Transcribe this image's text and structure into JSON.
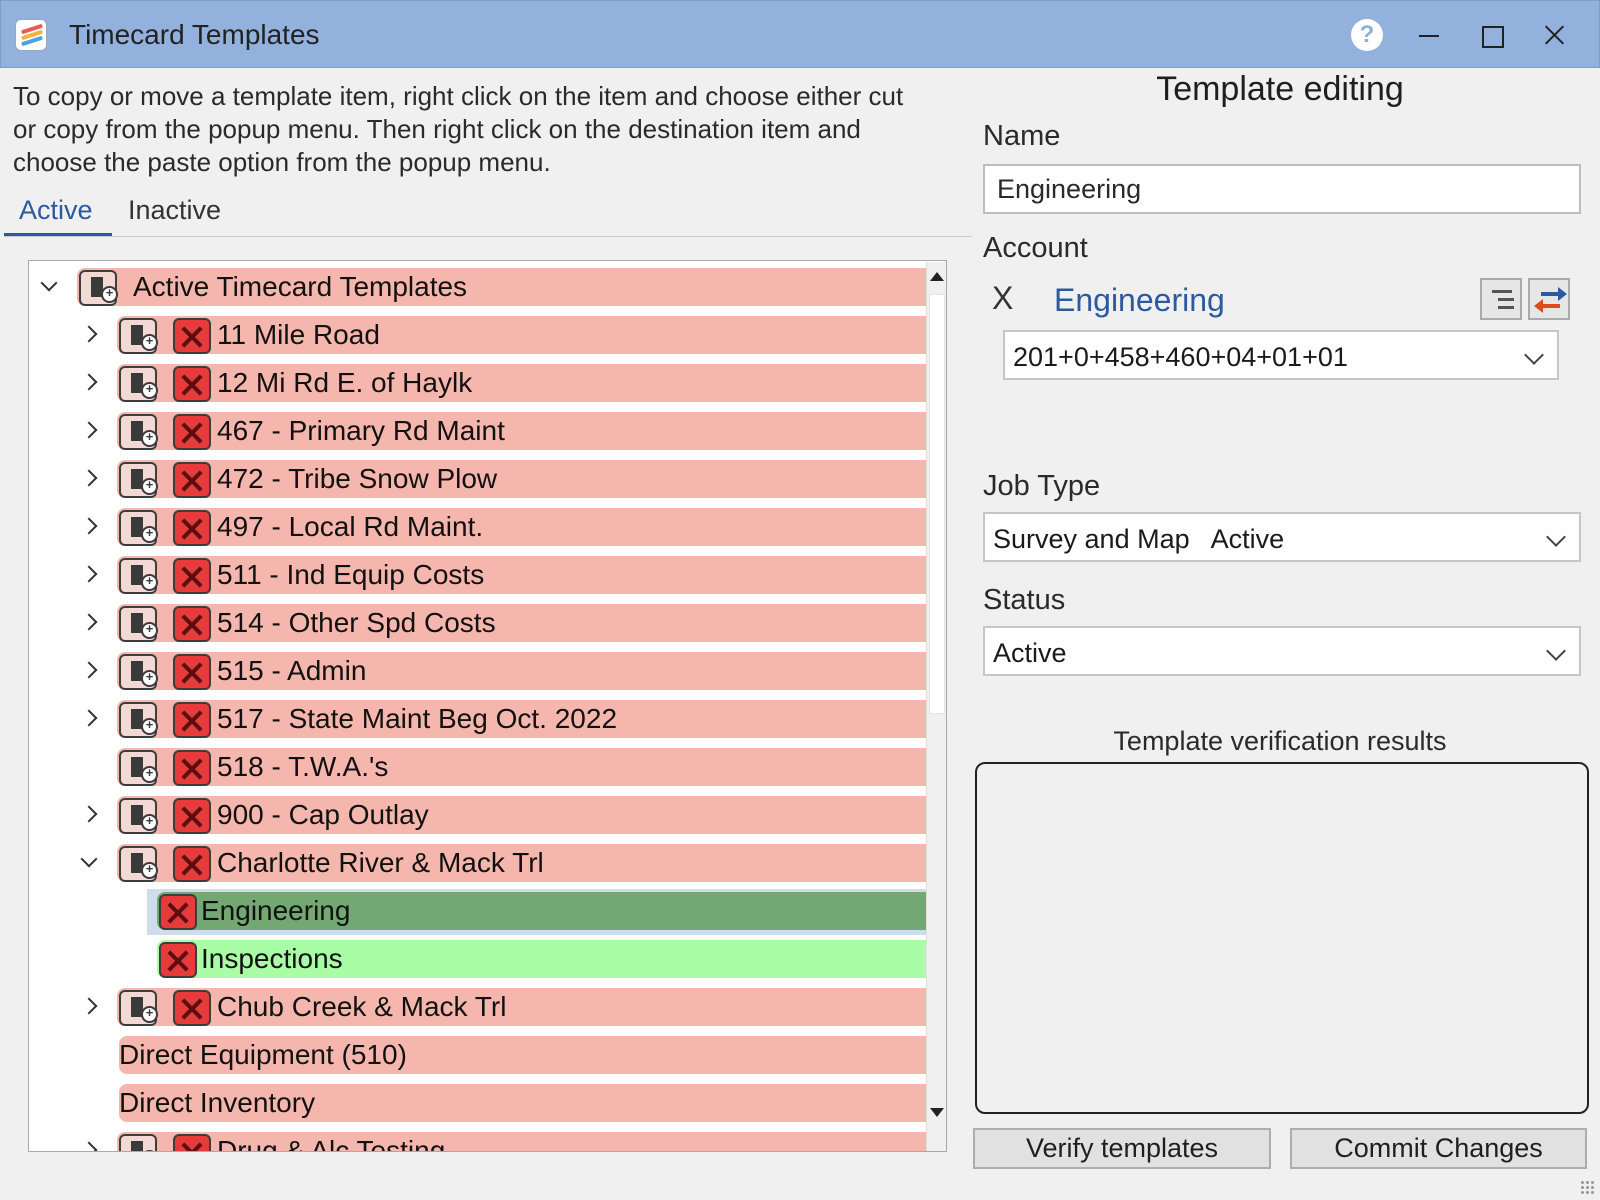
{
  "window": {
    "title": "Timecard Templates",
    "help_label": "?"
  },
  "instructions": "To copy or move a template item, right click on the item and choose either cut or copy from the popup menu. Then right click on the destination item and choose the paste option from the popup menu.",
  "tabs": [
    {
      "label": "Active",
      "selected": true
    },
    {
      "label": "Inactive",
      "selected": false
    }
  ],
  "tree": {
    "root": "Active Timecard Templates",
    "items": [
      {
        "label": "11 Mile Road",
        "expander": "closed"
      },
      {
        "label": "12 Mi Rd E. of Haylk",
        "expander": "closed"
      },
      {
        "label": "467 - Primary Rd Maint",
        "expander": "closed"
      },
      {
        "label": "472 - Tribe Snow Plow",
        "expander": "closed"
      },
      {
        "label": "497 - Local Rd Maint.",
        "expander": "closed"
      },
      {
        "label": "511 - Ind Equip Costs",
        "expander": "closed"
      },
      {
        "label": "514 - Other Spd Costs",
        "expander": "closed"
      },
      {
        "label": "515 - Admin",
        "expander": "closed"
      },
      {
        "label": "517 - State Maint Beg Oct. 2022",
        "expander": "closed"
      },
      {
        "label": "518 - T.W.A.'s",
        "expander": "none"
      },
      {
        "label": "900 - Cap Outlay",
        "expander": "closed"
      },
      {
        "label": "Charlotte River & Mack Trl",
        "expander": "open"
      },
      {
        "label": "Engineering",
        "child": true,
        "selected": true
      },
      {
        "label": "Inspections",
        "child": true
      },
      {
        "label": "Chub Creek & Mack Trl",
        "expander": "closed"
      },
      {
        "label": "Direct Equipment (510)",
        "plain": true
      },
      {
        "label": "Direct Inventory",
        "plain": true
      },
      {
        "label": "Drug & Alc Testing",
        "expander": "closed"
      }
    ]
  },
  "editor": {
    "title": "Template editing",
    "name_label": "Name",
    "name_value": "Engineering",
    "account_label": "Account",
    "account_clear": "X",
    "account_name": "Engineering",
    "account_number": "201+0+458+460+04+01+01",
    "job_type_label": "Job Type",
    "job_type_value": "Survey and Map   Active",
    "status_label": "Status",
    "status_value": "Active",
    "verification_title": "Template verification results",
    "verification_results": ""
  },
  "buttons": {
    "verify": "Verify templates",
    "commit": "Commit Changes"
  },
  "colors": {
    "titlebar": "#93b1dd",
    "row_pink": "#f5b6ae",
    "row_selected_green": "#74a873",
    "row_light_green": "#a9fda5",
    "accent_blue": "#2c5aa0"
  },
  "icons": {
    "add_template": "document-plus-icon",
    "delete": "red-x-delete-icon",
    "account_tree": "tree-list-icon",
    "account_swap": "swap-arrows-icon"
  }
}
